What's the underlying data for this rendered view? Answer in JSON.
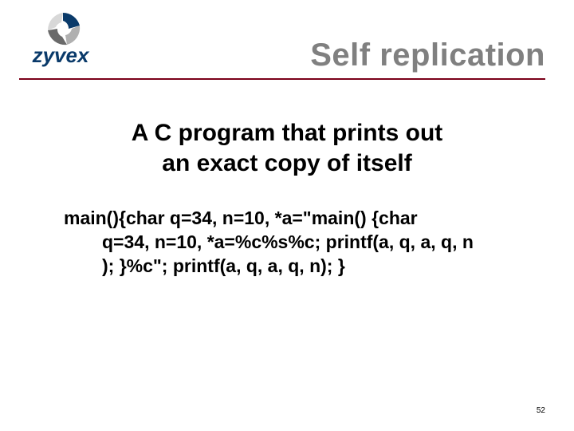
{
  "header": {
    "brand": "zyvex",
    "title": "Self replication"
  },
  "content": {
    "subtitle_line1": "A C program that prints out",
    "subtitle_line2": "an exact copy of itself",
    "code_line1": "main(){char q=34, n=10, *a=\"main() {char",
    "code_line2": "q=34, n=10, *a=%c%s%c; printf(a, q, a, q, n",
    "code_line3": "); }%c\"; printf(a, q, a, q, n); }"
  },
  "footer": {
    "page_number": "52"
  }
}
